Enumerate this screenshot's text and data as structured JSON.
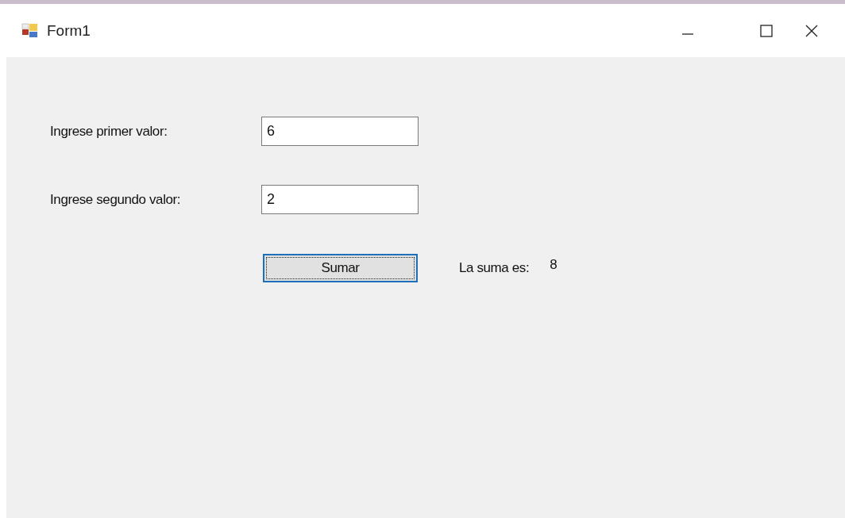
{
  "window": {
    "title": "Form1"
  },
  "fields": [
    {
      "label": "Ingrese primer valor:",
      "value": "6"
    },
    {
      "label": "Ingrese segundo valor:",
      "value": "2"
    }
  ],
  "button": {
    "label": "Sumar",
    "focused": true
  },
  "result": {
    "label": "La suma es:",
    "value": "8"
  }
}
